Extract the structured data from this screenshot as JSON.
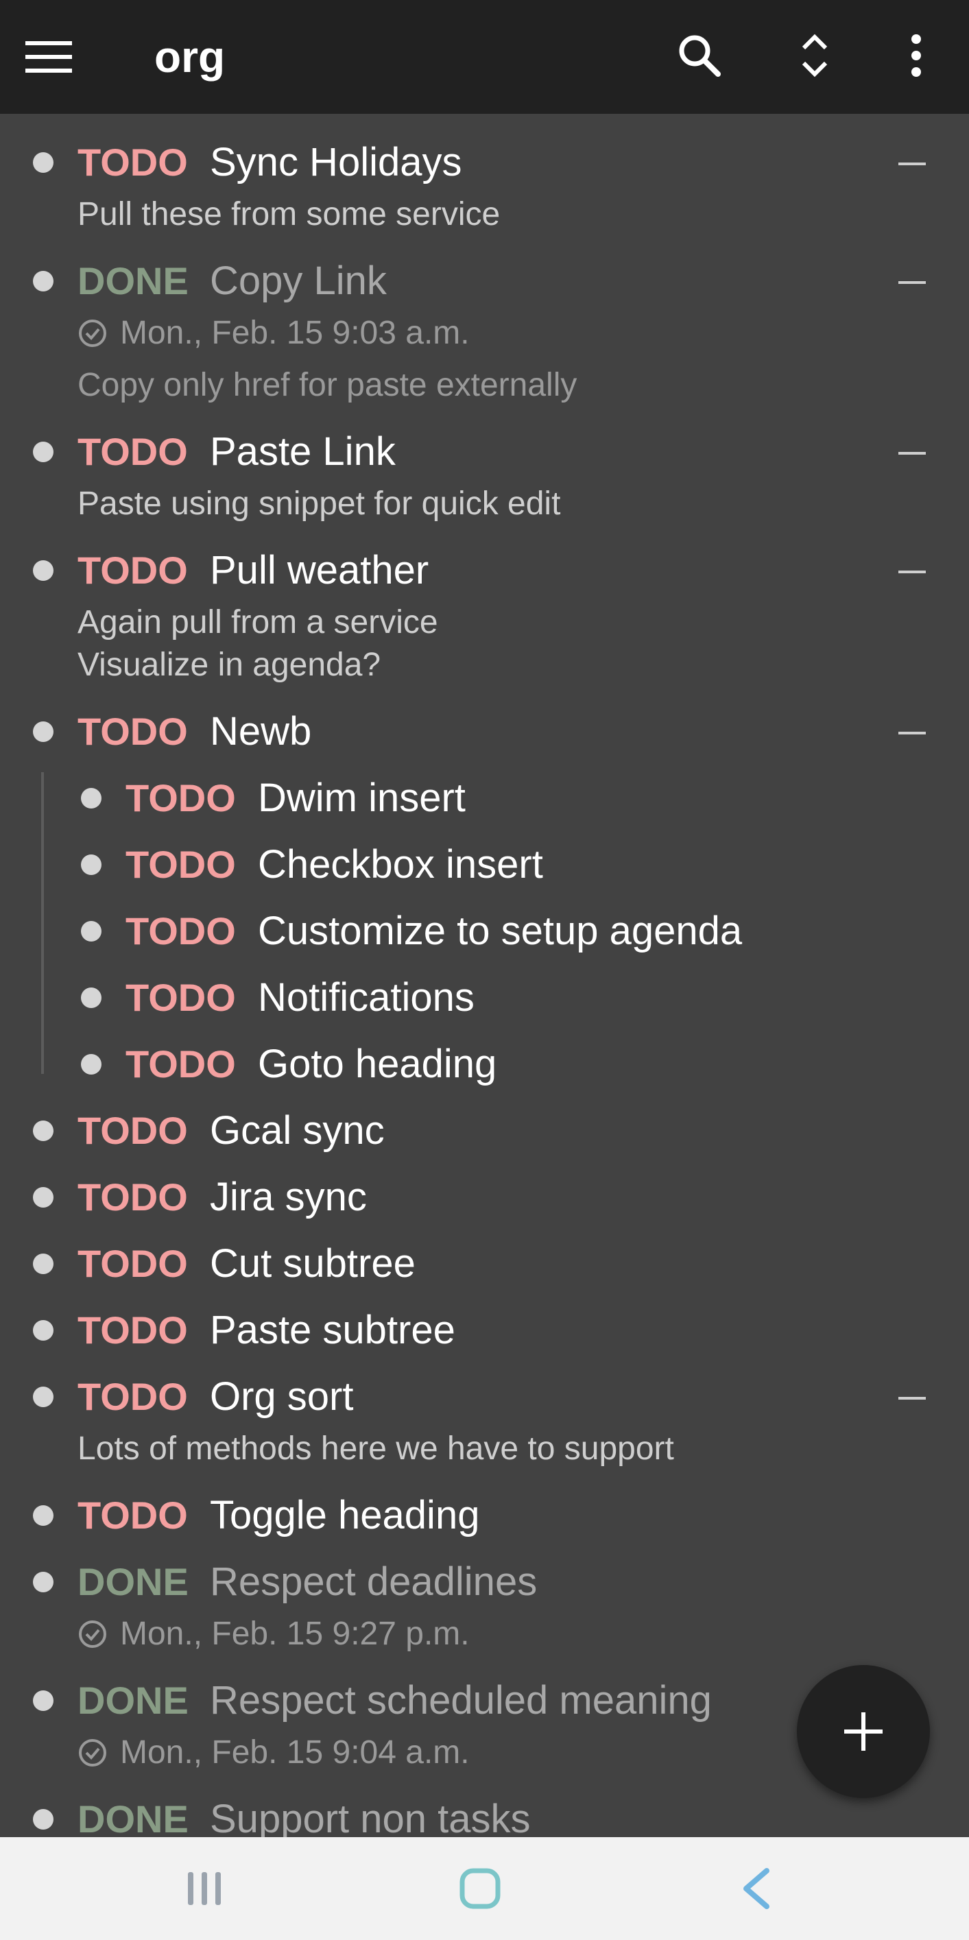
{
  "app_bar": {
    "title": "org",
    "menu_icon": "hamburger-menu-icon",
    "search_icon": "search-icon",
    "expand_icon": "unfold-expand-icon",
    "more_icon": "more-vert-icon"
  },
  "colors": {
    "todo": "#f4a0a0",
    "done": "#889c85",
    "background": "#424242",
    "app_bar": "#212121"
  },
  "items": [
    {
      "keyword": "TODO",
      "title": "Sync Holidays",
      "content": "Pull these from some service"
    },
    {
      "keyword": "DONE",
      "title": "Copy Link",
      "closed": "Mon., Feb. 15 9:03 a.m.",
      "content": "Copy only href for paste externally"
    },
    {
      "keyword": "TODO",
      "title": "Paste Link",
      "content": "Paste using snippet for quick edit"
    },
    {
      "keyword": "TODO",
      "title": "Pull weather",
      "content_line1": "Again pull from a service",
      "content_line2": "Visualize in agenda?"
    },
    {
      "keyword": "TODO",
      "title": "Newb",
      "children": [
        {
          "keyword": "TODO",
          "title": "Dwim insert"
        },
        {
          "keyword": "TODO",
          "title": "Checkbox insert"
        },
        {
          "keyword": "TODO",
          "title": "Customize to setup agenda"
        },
        {
          "keyword": "TODO",
          "title": "Notifications"
        },
        {
          "keyword": "TODO",
          "title": "Goto heading"
        }
      ]
    },
    {
      "keyword": "TODO",
      "title": "Gcal sync"
    },
    {
      "keyword": "TODO",
      "title": "Jira sync"
    },
    {
      "keyword": "TODO",
      "title": "Cut subtree"
    },
    {
      "keyword": "TODO",
      "title": "Paste subtree"
    },
    {
      "keyword": "TODO",
      "title": "Org sort",
      "content": "Lots of methods here we have to support"
    },
    {
      "keyword": "TODO",
      "title": "Toggle heading"
    },
    {
      "keyword": "DONE",
      "title": "Respect deadlines",
      "closed": "Mon., Feb. 15 9:27 p.m."
    },
    {
      "keyword": "DONE",
      "title": "Respect scheduled meaning",
      "closed": "Mon., Feb. 15 9:04 a.m."
    },
    {
      "keyword": "DONE",
      "title": "Support non tasks"
    }
  ],
  "fab": {
    "icon": "plus-icon"
  },
  "nav_bar": {
    "recents_icon": "recents-icon",
    "home_icon": "home-icon",
    "back_icon": "back-icon"
  }
}
